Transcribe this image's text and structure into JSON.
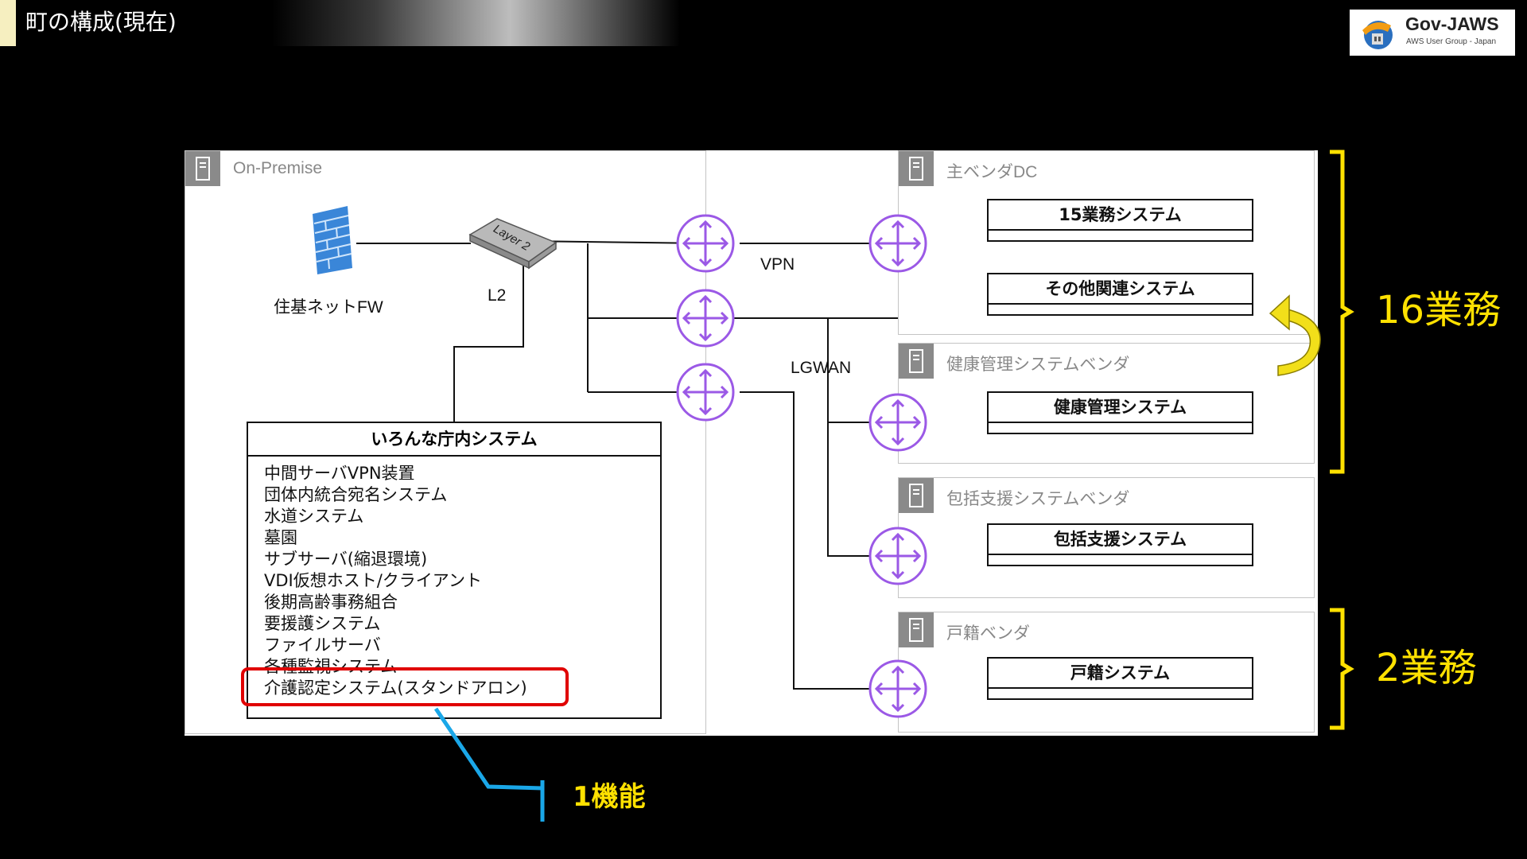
{
  "slide": {
    "title": "町の構成(現在)"
  },
  "logo": {
    "name": "Gov-JAWS",
    "subtitle": "AWS User Group - Japan"
  },
  "diagram": {
    "onprem": {
      "group_label": "On-Premise",
      "firewall_label": "住基ネットFW",
      "switch_text": "Layer 2",
      "switch_label": "L2"
    },
    "network_labels": {
      "vpn": "VPN",
      "lgwan": "LGWAN"
    },
    "vendors": {
      "main_dc": {
        "label": "主ベンダDC",
        "systems": [
          "15業務システム",
          "その他関連システム"
        ]
      },
      "health": {
        "label": "健康管理システムベンダ",
        "systems": [
          "健康管理システム"
        ]
      },
      "support": {
        "label": "包括支援システムベンダ",
        "systems": [
          "包括支援システム"
        ]
      },
      "koseki": {
        "label": "戸籍ベンダ",
        "systems": [
          "戸籍システム"
        ]
      }
    },
    "internal": {
      "title": "いろんな庁内システム",
      "items": [
        "中間サーバVPN装置",
        "団体内統合宛名システム",
        "水道システム",
        "墓園",
        "サブサーバ(縮退環境)",
        "VDI仮想ホスト/クライアント",
        "後期高齢事務組合",
        "要援護システム",
        "ファイルサーバ",
        "各種監視システム",
        "介護認定システム(スタンドアロン)"
      ]
    }
  },
  "annotations": {
    "group_16": "16業務",
    "group_2": "2業務",
    "function_note": "1機能"
  },
  "colors": {
    "router": "#9b59e6",
    "highlight": "#e00000",
    "annotation": "#ffe100",
    "callout_line": "#1aa7e8"
  }
}
